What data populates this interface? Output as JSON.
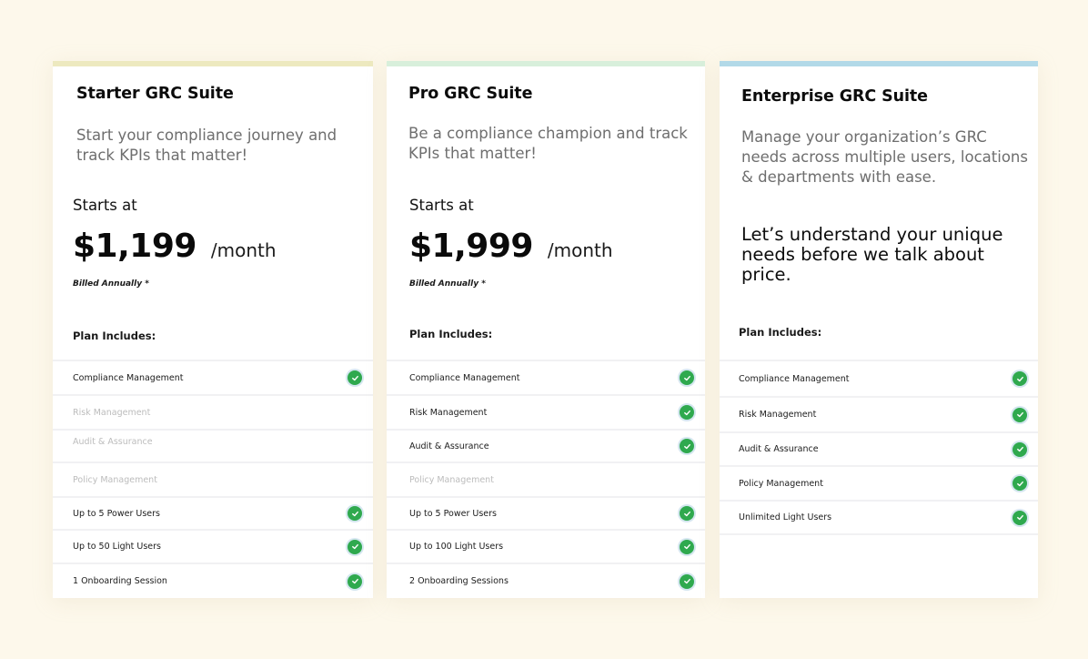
{
  "colors": {
    "background": "#fdf8eb",
    "starter_accent": "#ede9bf",
    "pro_accent": "#d8efdb",
    "enterprise_accent": "#b2d9e8",
    "check_green": "#2fa94e",
    "disabled_text": "#bcbcbc"
  },
  "plans": [
    {
      "title": "Starter GRC Suite",
      "tagline": "Start your compliance journey and track KPIs that matter!",
      "starts_label": "Starts at",
      "price": "$1,199",
      "period": "/month",
      "billing_note": "Billed Annually *",
      "includes_label": "Plan Includes:",
      "features": [
        {
          "label": "Compliance Management",
          "included": true,
          "icon": "check-circle-icon"
        },
        {
          "label": "Risk Management",
          "included": false
        },
        {
          "label": "Audit & Assurance",
          "included": false
        },
        {
          "label": "Policy Management",
          "included": false
        },
        {
          "label": "Up to 5 Power Users",
          "included": true,
          "icon": "check-circle-icon"
        },
        {
          "label": "Up to 50 Light Users",
          "included": true,
          "icon": "check-circle-icon"
        },
        {
          "label": "1 Onboarding Session",
          "included": true,
          "icon": "check-circle-icon"
        }
      ]
    },
    {
      "title": "Pro GRC Suite",
      "tagline": "Be a compliance champion and track KPIs that matter!",
      "starts_label": "Starts at",
      "price": "$1,999",
      "period": "/month",
      "billing_note": "Billed Annually *",
      "includes_label": "Plan Includes:",
      "features": [
        {
          "label": "Compliance Management",
          "included": true,
          "icon": "check-circle-icon"
        },
        {
          "label": "Risk Management",
          "included": true,
          "icon": "check-circle-icon"
        },
        {
          "label": "Audit & Assurance",
          "included": true,
          "icon": "check-circle-icon"
        },
        {
          "label": "Policy Management",
          "included": false
        },
        {
          "label": "Up to 5 Power Users",
          "included": true,
          "icon": "check-circle-icon"
        },
        {
          "label": "Up to 100 Light Users",
          "included": true,
          "icon": "check-circle-icon"
        },
        {
          "label": "2 Onboarding Sessions",
          "included": true,
          "icon": "check-circle-icon"
        }
      ]
    },
    {
      "title": "Enterprise GRC Suite",
      "tagline": "Manage your organization’s GRC needs across multiple users, locations & departments with ease.",
      "custom_note": "Let’s understand your unique needs before we talk about price.",
      "includes_label": "Plan Includes:",
      "features": [
        {
          "label": "Compliance Management",
          "included": true,
          "icon": "check-circle-icon"
        },
        {
          "label": "Risk Management",
          "included": true,
          "icon": "check-circle-icon"
        },
        {
          "label": "Audit & Assurance",
          "included": true,
          "icon": "check-circle-icon"
        },
        {
          "label": "Policy Management",
          "included": true,
          "icon": "check-circle-icon"
        },
        {
          "label": "Unlimited Light Users",
          "included": true,
          "icon": "check-circle-icon"
        }
      ]
    }
  ]
}
